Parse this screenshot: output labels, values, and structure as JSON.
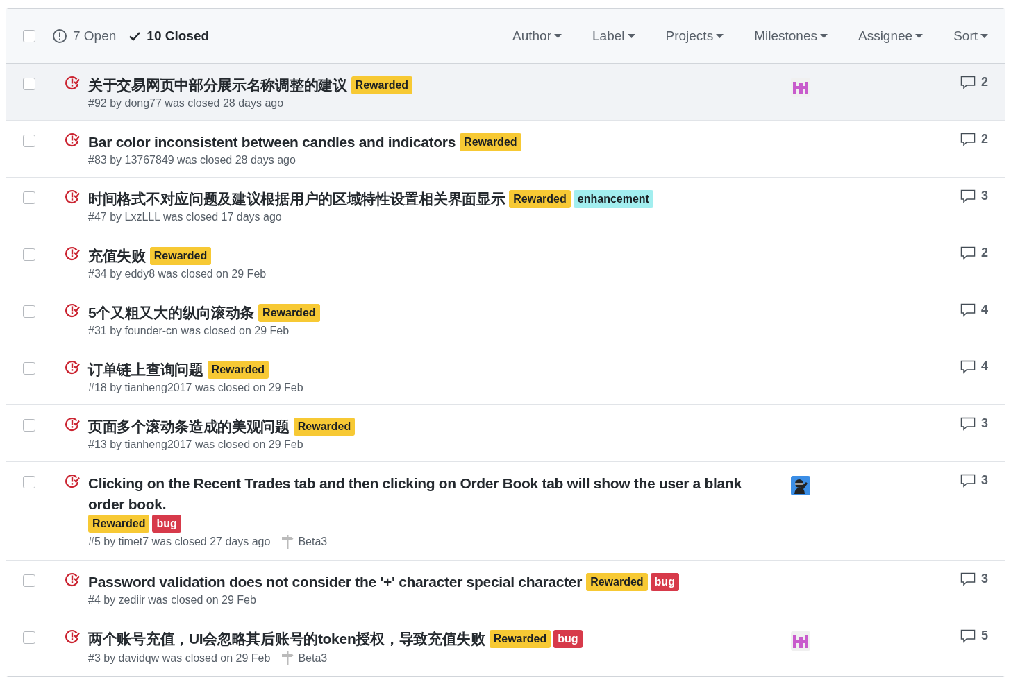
{
  "header": {
    "all_checked": false,
    "open_count": "7 Open",
    "closed_count": "10 Closed",
    "open_selected": false,
    "closed_selected": true,
    "filters": [
      "Author",
      "Label",
      "Projects",
      "Milestones",
      "Assignee",
      "Sort"
    ]
  },
  "issues": [
    {
      "checked": false,
      "title": "关于交易网页中部分展示名称调整的建议",
      "labels": [
        {
          "name": "Rewarded",
          "color": "#f7c934"
        }
      ],
      "meta": "#92 by dong77 was closed 28 days ago",
      "assignee": {
        "kind": "identicon"
      },
      "comments": "2",
      "highlighted": true
    },
    {
      "checked": false,
      "title": "Bar color inconsistent between candles and indicators",
      "labels": [
        {
          "name": "Rewarded",
          "color": "#f7c934"
        }
      ],
      "meta": "#83 by 13767849 was closed 28 days ago",
      "comments": "2",
      "highlighted": false
    },
    {
      "checked": false,
      "title": "时间格式不对应问题及建议根据用户的区域特性设置相关界面显示",
      "labels": [
        {
          "name": "Rewarded",
          "color": "#f7c934"
        },
        {
          "name": "enhancement",
          "color": "#a2eeef"
        }
      ],
      "meta": "#47 by LxzLLL was closed 17 days ago",
      "comments": "3",
      "highlighted": false
    },
    {
      "checked": false,
      "title": "充值失败",
      "labels": [
        {
          "name": "Rewarded",
          "color": "#f7c934"
        }
      ],
      "meta": "#34 by eddy8 was closed on 29 Feb",
      "comments": "2",
      "highlighted": false
    },
    {
      "checked": false,
      "title": "5个又粗又大的纵向滚动条",
      "labels": [
        {
          "name": "Rewarded",
          "color": "#f7c934"
        }
      ],
      "meta": "#31 by founder-cn was closed on 29 Feb",
      "comments": "4",
      "highlighted": false
    },
    {
      "checked": false,
      "title": "订单链上查询问题",
      "labels": [
        {
          "name": "Rewarded",
          "color": "#f7c934"
        }
      ],
      "meta": "#18 by tianheng2017 was closed on 29 Feb",
      "comments": "4",
      "highlighted": false
    },
    {
      "checked": false,
      "title": "页面多个滚动条造成的美观问题",
      "labels": [
        {
          "name": "Rewarded",
          "color": "#f7c934"
        }
      ],
      "meta": "#13 by tianheng2017 was closed on 29 Feb",
      "comments": "3",
      "highlighted": false
    },
    {
      "checked": false,
      "title": "Clicking on the Recent Trades tab and then clicking on Order Book tab will show the user a blank order book.",
      "labels": [
        {
          "name": "Rewarded",
          "color": "#f7c934"
        },
        {
          "name": "bug",
          "color": "#d73a4a"
        }
      ],
      "meta": "#5 by timet7 was closed 27 days ago",
      "milestone": "Beta3",
      "assignee": {
        "kind": "ninja"
      },
      "comments": "3",
      "highlighted": false
    },
    {
      "checked": false,
      "title": "Password validation does not consider the '+' character special character",
      "labels": [
        {
          "name": "Rewarded",
          "color": "#f7c934"
        },
        {
          "name": "bug",
          "color": "#d73a4a"
        }
      ],
      "meta": "#4 by zediir was closed on 29 Feb",
      "comments": "3",
      "highlighted": false
    },
    {
      "checked": false,
      "title": "两个账号充值，UI会忽略其后账号的token授权，导致充值失败",
      "labels": [
        {
          "name": "Rewarded",
          "color": "#f7c934"
        },
        {
          "name": "bug",
          "color": "#d73a4a"
        }
      ],
      "meta": "#3 by davidqw was closed on 29 Feb",
      "milestone": "Beta3",
      "assignee": {
        "kind": "identicon"
      },
      "comments": "5",
      "highlighted": false
    }
  ]
}
